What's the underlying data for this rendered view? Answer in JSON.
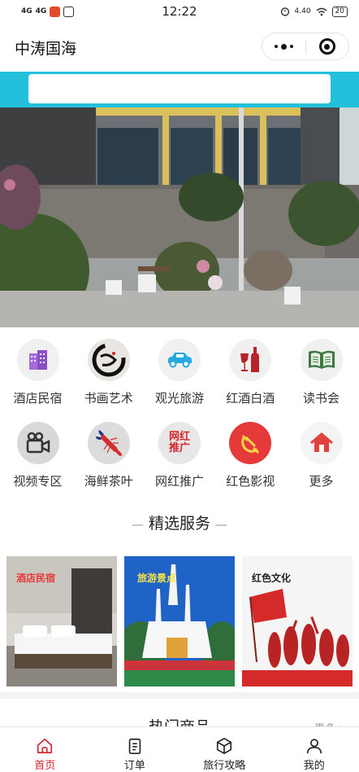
{
  "status_bar": {
    "signal_1": "4G",
    "signal_2": "4G",
    "time": "12:22",
    "speed": "4.40",
    "battery": "20"
  },
  "header": {
    "title": "中涛国海"
  },
  "search": {
    "placeholder": ""
  },
  "categories": [
    {
      "label": "酒店民宿",
      "icon": "hotel-building-icon"
    },
    {
      "label": "书画艺术",
      "icon": "calligraphy-icon"
    },
    {
      "label": "观光旅游",
      "icon": "car-icon"
    },
    {
      "label": "红酒白酒",
      "icon": "wine-bottle-icon"
    },
    {
      "label": "读书会",
      "icon": "open-book-icon"
    },
    {
      "label": "视频专区",
      "icon": "video-camera-icon"
    },
    {
      "label": "海鲜茶叶",
      "icon": "lobster-icon"
    },
    {
      "label": "网红推广",
      "icon": "influencer-badge-icon"
    },
    {
      "label": "红色影视",
      "icon": "hammer-sickle-icon"
    },
    {
      "label": "更多",
      "icon": "house-icon"
    }
  ],
  "influencer_badge": {
    "line1": "网红",
    "line2": "推广"
  },
  "section": {
    "title": "精选服务"
  },
  "services": [
    {
      "label": "酒店民宿"
    },
    {
      "label": "旅游景点"
    },
    {
      "label": "红色文化"
    }
  ],
  "hot": {
    "title": "热门商品",
    "more": "更多 >"
  },
  "tabs": [
    {
      "label": "首页",
      "icon": "home-icon",
      "active": true
    },
    {
      "label": "订单",
      "icon": "order-list-icon",
      "active": false
    },
    {
      "label": "旅行攻略",
      "icon": "cube-icon",
      "active": false
    },
    {
      "label": "我的",
      "icon": "user-icon",
      "active": false
    }
  ],
  "colors": {
    "accent_cyan": "#23c0dc",
    "active_red": "#d2252f"
  }
}
